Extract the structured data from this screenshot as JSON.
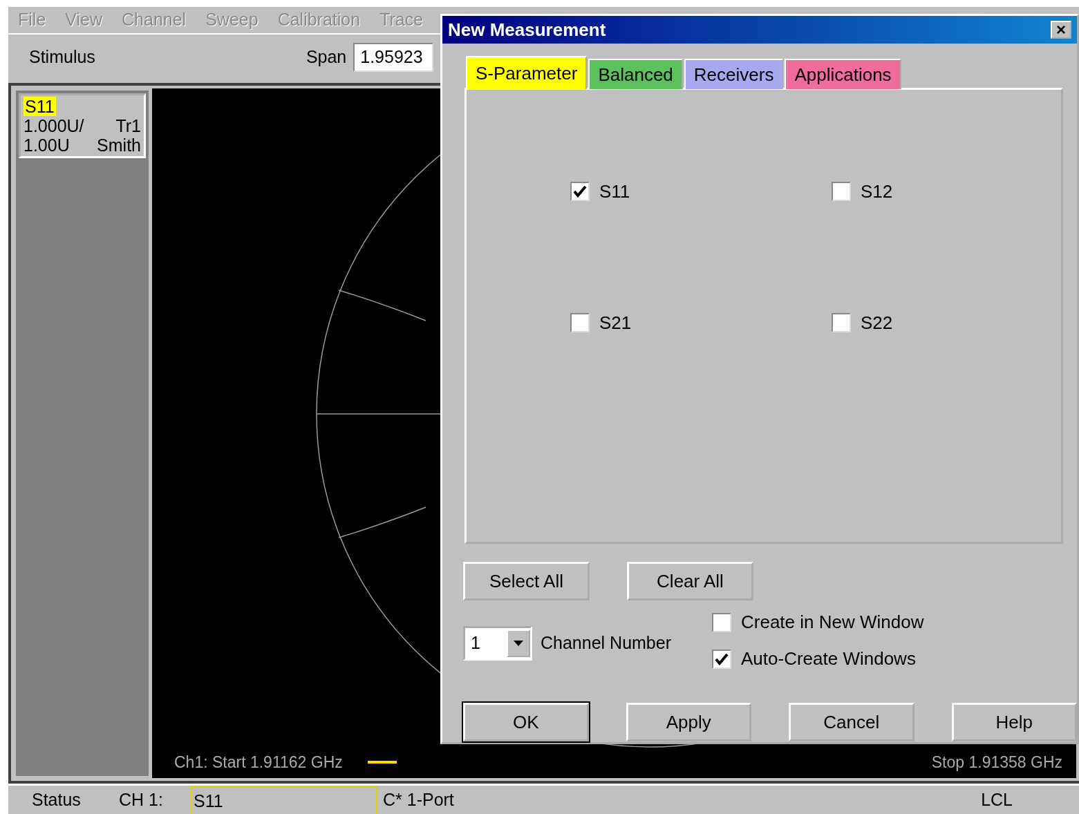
{
  "menu": [
    {
      "label": "File",
      "disabled": true
    },
    {
      "label": "View",
      "disabled": true
    },
    {
      "label": "Channel",
      "disabled": true
    },
    {
      "label": "Sweep",
      "disabled": true
    },
    {
      "label": "Calibration",
      "disabled": true
    },
    {
      "label": "Trace",
      "disabled": true
    }
  ],
  "toolbar": {
    "label": "Stimulus",
    "span_label": "Span",
    "span_value": "1.95923"
  },
  "trace_info": {
    "name": "S11",
    "scale": "1.000U/",
    "trace": "Tr1",
    "reference": "1.00U",
    "format": "Smith"
  },
  "chart_footer": {
    "start": "Ch1: Start  1.91162 GHz",
    "stop": "Stop  1.91358 GHz"
  },
  "status_bar": {
    "label": "Status",
    "channel": "CH 1:",
    "measurement": "S11",
    "calibration": "C* 1-Port",
    "mode": "LCL"
  },
  "dialog": {
    "title": "New Measurement",
    "close": "×",
    "tabs": [
      {
        "label": "S-Parameter",
        "selected": true,
        "color": "#ffff00"
      },
      {
        "label": "Balanced",
        "selected": false,
        "color": "#5cc05c"
      },
      {
        "label": "Receivers",
        "selected": false,
        "color": "#a8a8f0"
      },
      {
        "label": "Applications",
        "selected": false,
        "color": "#f06c9c"
      }
    ],
    "parameters": [
      {
        "label": "S11",
        "checked": true
      },
      {
        "label": "S12",
        "checked": false
      },
      {
        "label": "S21",
        "checked": false
      },
      {
        "label": "S22",
        "checked": false
      }
    ],
    "select_all": "Select All",
    "clear_all": "Clear All",
    "channel": {
      "value": "1",
      "label": "Channel Number"
    },
    "options": [
      {
        "label": "Create in New Window",
        "checked": false
      },
      {
        "label": "Auto-Create Windows",
        "checked": true
      }
    ],
    "buttons": [
      {
        "label": "OK",
        "default": true
      },
      {
        "label": "Apply",
        "default": false
      },
      {
        "label": "Cancel",
        "default": false
      },
      {
        "label": "Help",
        "default": false
      }
    ]
  }
}
